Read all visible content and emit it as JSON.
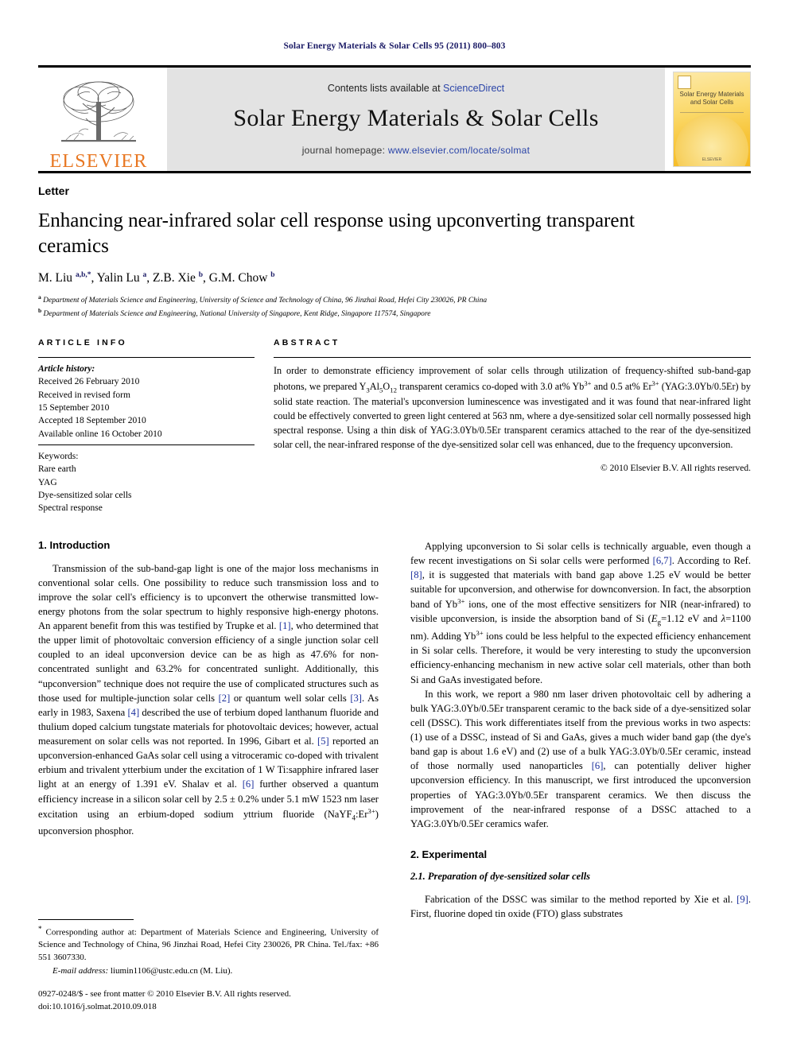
{
  "running_head": "Solar Energy Materials & Solar Cells 95 (2011) 800–803",
  "masthead": {
    "publisher_wordmark": "ELSEVIER",
    "contents_prefix": "Contents lists available at ",
    "contents_link": "ScienceDirect",
    "journal_name": "Solar Energy Materials & Solar Cells",
    "homepage_prefix": "journal homepage: ",
    "homepage_url": "www.elsevier.com/locate/solmat",
    "cover_title": "Solar Energy Materials and Solar Cells",
    "cover_footer": "ELSEVIER",
    "link_color": "#2b45a8",
    "wordmark_color": "#e87722",
    "band_color": "#e3e3e3"
  },
  "article": {
    "doc_type": "Letter",
    "title": "Enhancing near-infrared solar cell response using upconverting transparent ceramics",
    "authors_html": "M. Liu <sup>a,b,</sup><sup>*</sup>, Yalin Lu <sup>a</sup>, Z.B. Xie <sup>b</sup>, G.M. Chow <sup>b</sup>",
    "affiliations": [
      "a Department of Materials Science and Engineering, University of Science and Technology of China, 96 Jinzhai Road, Hefei City 230026, PR China",
      "b Department of Materials Science and Engineering, National University of Singapore, Kent Ridge, Singapore 117574, Singapore"
    ]
  },
  "article_info": {
    "heading": "ARTICLE INFO",
    "history_label": "Article history:",
    "history": [
      "Received 26 February 2010",
      "Received in revised form",
      "15 September 2010",
      "Accepted 18 September 2010",
      "Available online 16 October 2010"
    ],
    "keywords_label": "Keywords:",
    "keywords": [
      "Rare earth",
      "YAG",
      "Dye-sensitized solar cells",
      "Spectral response"
    ]
  },
  "abstract": {
    "heading": "ABSTRACT",
    "text_html": "In order to demonstrate efficiency improvement of solar cells through utilization of frequency-shifted sub-band-gap photons, we prepared Y<sub>3</sub>Al<sub>5</sub>O<sub>12</sub> transparent ceramics co-doped with 3.0 at% Yb<sup class=\"chg\">3+</sup> and 0.5 at% Er<sup class=\"chg\">3+</sup> (YAG:3.0Yb/0.5Er) by solid state reaction. The material's upconversion luminescence was investigated and it was found that near-infrared light could be effectively converted to green light centered at 563 nm, where a dye-sensitized solar cell normally possessed high spectral response. Using a thin disk of YAG:3.0Yb/0.5Er transparent ceramics attached to the rear of the dye-sensitized solar cell, the near-infrared response of the dye-sensitized solar cell was enhanced, due to the frequency upconversion.",
    "copyright": "© 2010 Elsevier B.V. All rights reserved."
  },
  "sections": {
    "intro_heading": "1.  Introduction",
    "intro_p1_html": "Transmission of the sub-band-gap light is one of the major loss mechanisms in conventional solar cells. One possibility to reduce such transmission loss and to improve the solar cell's efficiency is to upconvert the otherwise transmitted low-energy photons from the solar spectrum to highly responsive high-energy photons. An apparent benefit from this was testified by Trupke et al. <span class=\"ref\">[1]</span>, who determined that the upper limit of photovoltaic conversion efficiency of a single junction solar cell coupled to an ideal upconversion device can be as high as 47.6% for non-concentrated sunlight and 63.2% for concentrated sunlight. Additionally, this “upconversion” technique does not require the use of complicated structures such as those used for multiple-junction solar cells <span class=\"ref\">[2]</span> or quantum well solar cells <span class=\"ref\">[3]</span>. As early in 1983, Saxena <span class=\"ref\">[4]</span> described the use of terbium doped lanthanum fluoride and thulium doped calcium tungstate materials for photovoltaic devices; however, actual measurement on solar cells was not reported. In 1996, Gibart et al. <span class=\"ref\">[5]</span> reported an upconversion-enhanced GaAs solar cell using a vitroceramic co-doped with trivalent erbium and trivalent ytterbium under the excitation of 1 W Ti:sapphire infrared laser light at an energy of 1.391 eV. Shalav et al. <span class=\"ref\">[6]</span> further observed a quantum efficiency increase in a silicon solar cell by 2.5 <span class=\"nobr\">± 0.2%</span> under 5.1 mW 1523 nm laser excitation using an erbium-doped sodium yttrium fluoride (NaYF<sub>4</sub>:Er<sup class=\"chg\">3+</sup>) upconversion phosphor.",
    "right_p1_html": "Applying upconversion to Si solar cells is technically arguable, even though a few recent investigations on Si solar cells were performed <span class=\"ref\">[6,7]</span>. According to Ref. <span class=\"ref\">[8]</span>, it is suggested that materials with band gap above 1.25 eV would be better suitable for upconversion, and otherwise for downconversion. In fact, the absorption band of Yb<sup class=\"chg\">3+</sup> ions, one of the most effective sensitizers for NIR (near-infrared) to visible upconversion, is inside the absorption band of Si (<i>E</i><sub>g</sub>=1.12 eV and <i>λ</i>=1100 nm). Adding Yb<sup class=\"chg\">3+</sup> ions could be less helpful to the expected efficiency enhancement in Si solar cells. Therefore, it would be very interesting to study the upconversion efficiency-enhancing mechanism in new active solar cell materials, other than both Si and GaAs investigated before.",
    "right_p2_html": "In this work, we report a 980 nm laser driven photovoltaic cell by adhering a bulk YAG:3.0Yb/0.5Er transparent ceramic to the back side of a dye-sensitized solar cell (DSSC). This work differentiates itself from the previous works in two aspects: (1) use of a DSSC, instead of Si and GaAs, gives a much wider band gap (the dye's band gap is about 1.6 eV) and (2) use of a bulk YAG:3.0Yb/0.5Er ceramic, instead of those normally used nanoparticles <span class=\"ref\">[6]</span>, can potentially deliver higher upconversion efficiency. In this manuscript, we first introduced the upconversion properties of YAG:3.0Yb/0.5Er transparent ceramics. We then discuss the improvement of the near-infrared response of a DSSC attached to a YAG:3.0Yb/0.5Er ceramics wafer.",
    "experimental_heading": "2.  Experimental",
    "experimental_sub": "2.1.  Preparation of dye-sensitized solar cells",
    "experimental_p1_html": "Fabrication of the DSSC was similar to the method reported by Xie et al. <span class=\"ref\">[9]</span>. First, fluorine doped tin oxide (FTO) glass substrates"
  },
  "footnote": {
    "text_html": "<sup>*</sup> Corresponding author at: Department of Materials Science and Engineering, University of Science and Technology of China, 96 Jinzhai Road, Hefei City 230026, PR China. Tel./fax: +86 551 3607330.",
    "email_label": "E-mail address:",
    "email": "liumin1106@ustc.edu.cn (M. Liu)."
  },
  "page_footer": {
    "line1": "0927-0248/$ - see front matter © 2010 Elsevier B.V. All rights reserved.",
    "line2": "doi:10.1016/j.solmat.2010.09.018"
  }
}
